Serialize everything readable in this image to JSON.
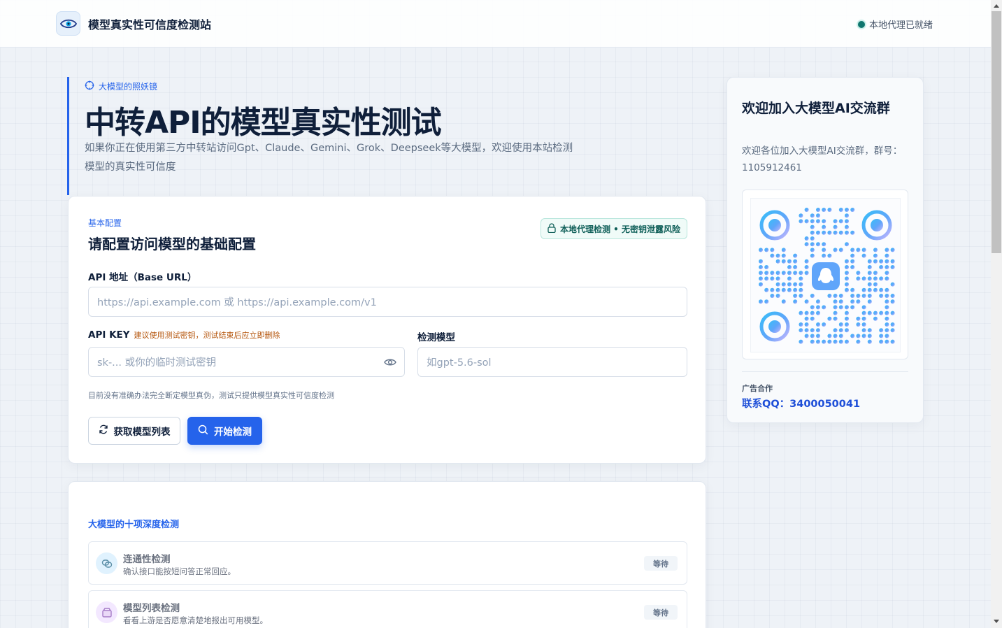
{
  "header": {
    "site_title": "模型真实性可信度检测站",
    "proxy_status": "本地代理已就绪"
  },
  "hero": {
    "eyebrow": "大模型的照妖镜",
    "title": "中转API的模型真实性测试",
    "description": "如果你正在使用第三方中转站访问Gpt、Claude、Gemini、Grok、Deepseek等大模型，欢迎使用本站检测模型的真实性可信度"
  },
  "config": {
    "eyebrow": "基本配置",
    "title": "请配置访问模型的基础配置",
    "secure_badge": "本地代理检测 • 无密钥泄露风险",
    "base_url": {
      "label": "API 地址（Base URL）",
      "placeholder": "https://api.example.com 或 https://api.example.com/v1",
      "value": ""
    },
    "api_key": {
      "label": "API KEY",
      "note": "建议使用测试密钥，测试结束后应立即删除",
      "placeholder": "sk-... 或你的临时测试密钥",
      "value": ""
    },
    "model": {
      "label": "检测模型",
      "placeholder": "如gpt-5.6-sol",
      "value": ""
    },
    "hint": "目前没有准确办法完全断定模型真伪，测试只提供模型真实性可信度检测",
    "fetch_models_label": "获取模型列表",
    "start_label": "开始检测"
  },
  "checks": {
    "title": "大模型的十项深度检测",
    "items": [
      {
        "name": "连通性检测",
        "description": "确认接口能按短问答正常回应。",
        "status": "等待",
        "icon": "link-icon"
      },
      {
        "name": "模型列表检测",
        "description": "看看上游是否愿意清楚地报出可用模型。",
        "status": "等待",
        "icon": "list-box-icon"
      }
    ]
  },
  "side": {
    "title": "欢迎加入大模型AI交流群",
    "description": "欢迎各位加入大模型AI交流群，群号：1105912461",
    "ad_label": "广告合作",
    "ad_contact": "联系QQ：3400050041"
  },
  "colors": {
    "accent": "#2563eb",
    "status_ok": "#0f766e",
    "warning_note": "#b45309"
  }
}
